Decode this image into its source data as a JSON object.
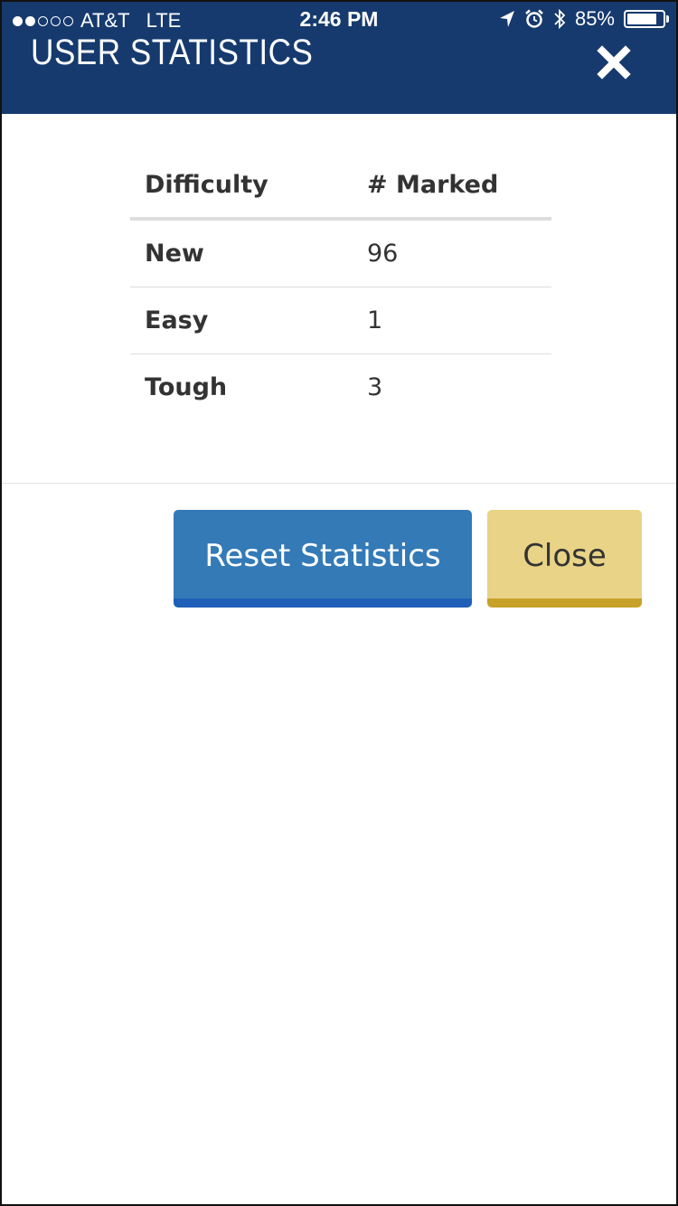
{
  "status_bar": {
    "carrier": "AT&T",
    "network": "LTE",
    "time": "2:46 PM",
    "battery_percent": "85%",
    "battery_level": 0.85,
    "signal_bars_filled": 2,
    "signal_bars_total": 5
  },
  "header": {
    "title": "USER STATISTICS",
    "background_color": "#163a6e"
  },
  "table": {
    "headers": [
      "Difficulty",
      "# Marked"
    ],
    "rows": [
      {
        "difficulty": "New",
        "marked": "96"
      },
      {
        "difficulty": "Easy",
        "marked": "1"
      },
      {
        "difficulty": "Tough",
        "marked": "3"
      }
    ]
  },
  "buttons": {
    "reset_label": "Reset Statistics",
    "close_label": "Close",
    "reset_color": "#337ab7",
    "close_color": "#e8d386"
  },
  "icons": {
    "header_close": "close-icon",
    "location": "location-arrow-icon",
    "alarm": "alarm-clock-icon",
    "bluetooth": "bluetooth-icon",
    "battery": "battery-icon"
  }
}
